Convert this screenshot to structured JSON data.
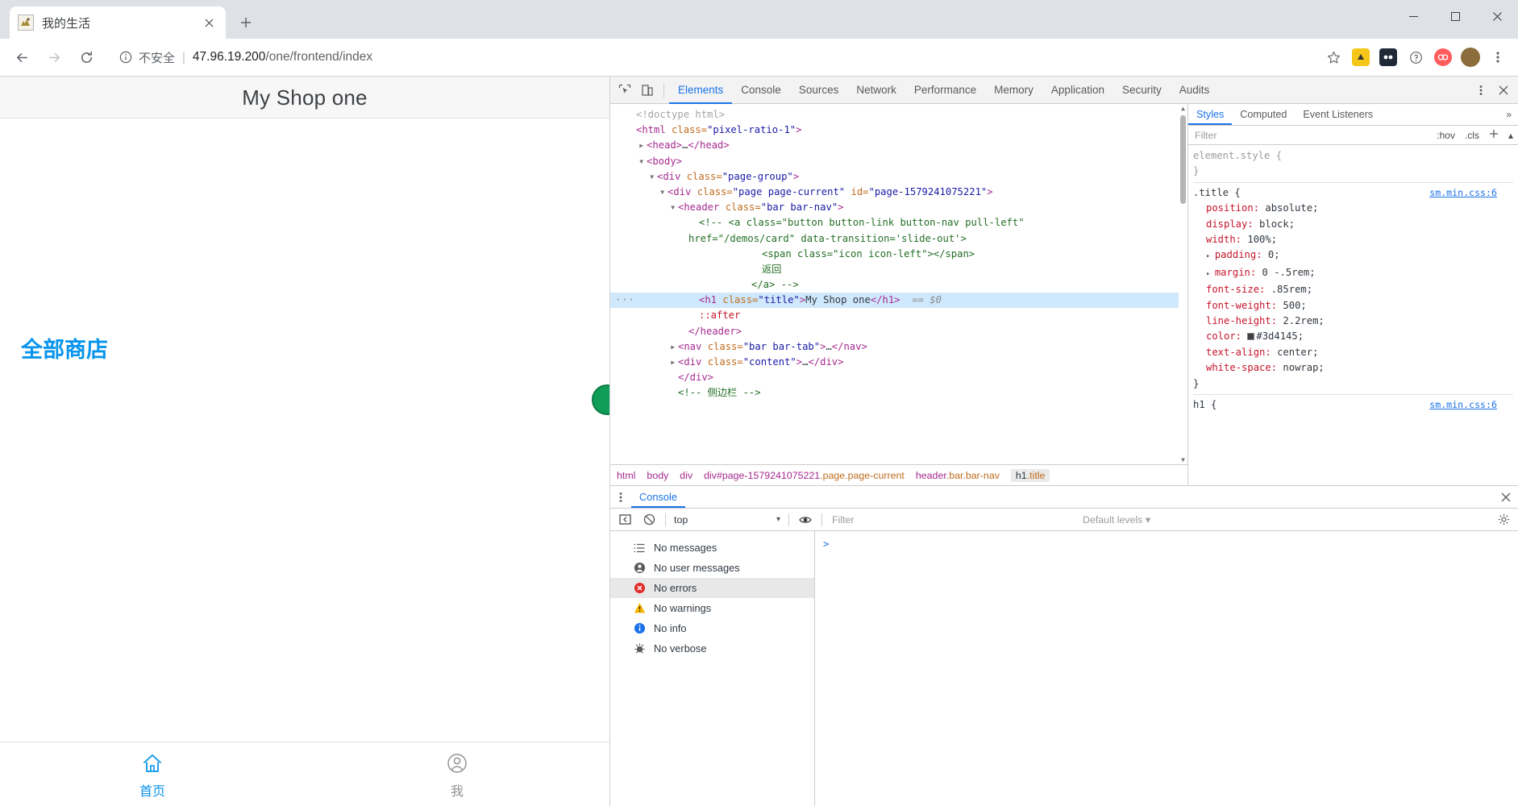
{
  "browser": {
    "tab": {
      "title": "我的生活",
      "favicon_icon": "page-favicon",
      "close_icon": "close-icon"
    },
    "newtab_icon": "plus-icon",
    "window_controls": {
      "minimize": "minimize-icon",
      "maximize": "maximize-icon",
      "close": "close-icon"
    },
    "nav": {
      "back_icon": "back-arrow-icon",
      "forward_icon": "forward-arrow-icon",
      "reload_icon": "reload-icon"
    },
    "omnibox": {
      "info_icon": "info-circle-icon",
      "security_label": "不安全",
      "separator": "|",
      "url_host": "47.96.19.200",
      "url_path": "/one/frontend/index"
    },
    "toolbar_icons": {
      "bookmark": "star-icon",
      "extension_1": "extension-yellow-icon",
      "extension_2": "extension-dark-icon",
      "help": "help-circle-icon",
      "extension_3": "extension-red-icon",
      "profile": "avatar-icon",
      "menu": "three-dot-menu-icon"
    }
  },
  "page": {
    "title": "My Shop one",
    "store_link": "全部商店",
    "tabbar": [
      {
        "label": "首页",
        "icon": "home-icon",
        "active": true
      },
      {
        "label": "我",
        "icon": "user-icon",
        "active": false
      }
    ],
    "accent_color": "#0894ec",
    "title_color": "#3d4145"
  },
  "devtools": {
    "toolbar": {
      "inspect_icon": "inspect-element-icon",
      "device_icon": "device-toolbar-icon",
      "more_icon": "three-dot-menu-icon",
      "close_icon": "close-icon",
      "tabs": [
        {
          "label": "Elements",
          "active": true
        },
        {
          "label": "Console",
          "active": false
        },
        {
          "label": "Sources",
          "active": false
        },
        {
          "label": "Network",
          "active": false
        },
        {
          "label": "Performance",
          "active": false
        },
        {
          "label": "Memory",
          "active": false
        },
        {
          "label": "Application",
          "active": false
        },
        {
          "label": "Security",
          "active": false
        },
        {
          "label": "Audits",
          "active": false
        }
      ]
    },
    "dom_lines": [
      {
        "indent": 0,
        "arrow": "",
        "selected": false,
        "parts": [
          {
            "t": "doctype",
            "s": "<!doctype html>"
          }
        ]
      },
      {
        "indent": 0,
        "arrow": "",
        "selected": false,
        "parts": [
          {
            "t": "tag",
            "s": "<html "
          },
          {
            "t": "attr",
            "s": "class="
          },
          {
            "t": "val",
            "s": "\"pixel-ratio-1\""
          },
          {
            "t": "tag",
            "s": ">"
          }
        ]
      },
      {
        "indent": 1,
        "arrow": "collapsed",
        "selected": false,
        "parts": [
          {
            "t": "tag",
            "s": "<head>"
          },
          {
            "t": "text",
            "s": "…"
          },
          {
            "t": "tag",
            "s": "</head>"
          }
        ]
      },
      {
        "indent": 1,
        "arrow": "expanded",
        "selected": false,
        "parts": [
          {
            "t": "tag",
            "s": "<body>"
          }
        ]
      },
      {
        "indent": 2,
        "arrow": "expanded",
        "selected": false,
        "parts": [
          {
            "t": "tag",
            "s": "<div "
          },
          {
            "t": "attr",
            "s": "class="
          },
          {
            "t": "val",
            "s": "\"page-group\""
          },
          {
            "t": "tag",
            "s": ">"
          }
        ]
      },
      {
        "indent": 3,
        "arrow": "expanded",
        "selected": false,
        "parts": [
          {
            "t": "tag",
            "s": "<div "
          },
          {
            "t": "attr",
            "s": "class="
          },
          {
            "t": "val",
            "s": "\"page page-current\""
          },
          {
            "t": "attr",
            "s": " id="
          },
          {
            "t": "val",
            "s": "\"page-1579241075221\""
          },
          {
            "t": "tag",
            "s": ">"
          }
        ]
      },
      {
        "indent": 4,
        "arrow": "expanded",
        "selected": false,
        "parts": [
          {
            "t": "tag",
            "s": "<header "
          },
          {
            "t": "attr",
            "s": "class="
          },
          {
            "t": "val",
            "s": "\"bar bar-nav\""
          },
          {
            "t": "tag",
            "s": ">"
          }
        ]
      },
      {
        "indent": 6,
        "arrow": "",
        "selected": false,
        "parts": [
          {
            "t": "comment",
            "s": "<!-- <a class=\"button button-link button-nav pull-left\""
          }
        ]
      },
      {
        "indent": 5,
        "arrow": "",
        "selected": false,
        "parts": [
          {
            "t": "comment",
            "s": "href=\"/demos/card\" data-transition='slide-out'>"
          }
        ]
      },
      {
        "indent": 12,
        "arrow": "",
        "selected": false,
        "parts": [
          {
            "t": "comment",
            "s": "<span class=\"icon icon-left\"></span>"
          }
        ]
      },
      {
        "indent": 12,
        "arrow": "",
        "selected": false,
        "parts": [
          {
            "t": "comment",
            "s": "返回"
          }
        ]
      },
      {
        "indent": 11,
        "arrow": "",
        "selected": false,
        "parts": [
          {
            "t": "comment",
            "s": "</a> -->"
          }
        ]
      },
      {
        "indent": 6,
        "arrow": "dots",
        "selected": true,
        "parts": [
          {
            "t": "tag",
            "s": "<h1 "
          },
          {
            "t": "attr",
            "s": "class="
          },
          {
            "t": "val",
            "s": "\"title\""
          },
          {
            "t": "tag",
            "s": ">"
          },
          {
            "t": "text",
            "s": "My Shop one"
          },
          {
            "t": "tag",
            "s": "</h1>"
          },
          {
            "t": "eq",
            "s": "  == $0"
          }
        ]
      },
      {
        "indent": 6,
        "arrow": "",
        "selected": false,
        "parts": [
          {
            "t": "pseudo",
            "s": "::after"
          }
        ]
      },
      {
        "indent": 5,
        "arrow": "",
        "selected": false,
        "parts": [
          {
            "t": "tag",
            "s": "</header>"
          }
        ]
      },
      {
        "indent": 4,
        "arrow": "collapsed",
        "selected": false,
        "parts": [
          {
            "t": "tag",
            "s": "<nav "
          },
          {
            "t": "attr",
            "s": "class="
          },
          {
            "t": "val",
            "s": "\"bar bar-tab\""
          },
          {
            "t": "tag",
            "s": ">"
          },
          {
            "t": "text",
            "s": "…"
          },
          {
            "t": "tag",
            "s": "</nav>"
          }
        ]
      },
      {
        "indent": 4,
        "arrow": "collapsed",
        "selected": false,
        "parts": [
          {
            "t": "tag",
            "s": "<div "
          },
          {
            "t": "attr",
            "s": "class="
          },
          {
            "t": "val",
            "s": "\"content\""
          },
          {
            "t": "tag",
            "s": ">"
          },
          {
            "t": "text",
            "s": "…"
          },
          {
            "t": "tag",
            "s": "</div>"
          }
        ]
      },
      {
        "indent": 4,
        "arrow": "",
        "selected": false,
        "parts": [
          {
            "t": "tag",
            "s": "</div>"
          }
        ]
      },
      {
        "indent": 4,
        "arrow": "",
        "selected": false,
        "parts": [
          {
            "t": "comment",
            "s": "<!-- 侧边栏 -->"
          }
        ]
      }
    ],
    "breadcrumb": [
      {
        "text": "html",
        "cls": ""
      },
      {
        "text": "body",
        "cls": ""
      },
      {
        "text": "div",
        "cls": ""
      },
      {
        "text": "div#page-1579241075221",
        "cls": ".page.page-current"
      },
      {
        "text": "header",
        "cls": ".bar.bar-nav"
      },
      {
        "text": "h1",
        "cls": ".title",
        "last": true
      }
    ],
    "styles": {
      "tabs": [
        {
          "label": "Styles",
          "active": true
        },
        {
          "label": "Computed",
          "active": false
        },
        {
          "label": "Event Listeners",
          "active": false
        }
      ],
      "more_icon": "chevron-double-right-icon",
      "filter_placeholder": "Filter",
      "hov_label": ":hov",
      "cls_label": ".cls",
      "new_rule_icon": "plus-icon",
      "rules": [
        {
          "selector": "element.style {",
          "selector_muted": true,
          "origin": "",
          "props": [],
          "close": "}"
        },
        {
          "selector": ".title {",
          "selector_muted": false,
          "origin": "sm.min.css:6",
          "props": [
            {
              "name": "position",
              "value": "absolute;",
              "tri": false,
              "swatch": ""
            },
            {
              "name": "display",
              "value": "block;",
              "tri": false,
              "swatch": ""
            },
            {
              "name": "width",
              "value": "100%;",
              "tri": false,
              "swatch": ""
            },
            {
              "name": "padding",
              "value": "0;",
              "tri": true,
              "swatch": ""
            },
            {
              "name": "margin",
              "value": "0 -.5rem;",
              "tri": true,
              "swatch": ""
            },
            {
              "name": "font-size",
              "value": ".85rem;",
              "tri": false,
              "swatch": ""
            },
            {
              "name": "font-weight",
              "value": "500;",
              "tri": false,
              "swatch": ""
            },
            {
              "name": "line-height",
              "value": "2.2rem;",
              "tri": false,
              "swatch": ""
            },
            {
              "name": "color",
              "value": "#3d4145;",
              "tri": false,
              "swatch": "#3d4145"
            },
            {
              "name": "text-align",
              "value": "center;",
              "tri": false,
              "swatch": ""
            },
            {
              "name": "white-space",
              "value": "nowrap;",
              "tri": false,
              "swatch": ""
            }
          ],
          "close": "}"
        },
        {
          "selector": "h1 {",
          "selector_muted": false,
          "origin": "sm.min.css:6",
          "props": [],
          "close": ""
        }
      ]
    },
    "drawer": {
      "dots_icon": "three-dot-menu-icon",
      "tab": "Console",
      "close_icon": "close-icon",
      "toolbar": {
        "sidebar_icon": "show-console-sidebar-icon",
        "clear_icon": "clear-console-icon",
        "context": "top",
        "context_caret": "▾",
        "eye_icon": "live-expression-icon",
        "filter_placeholder": "Filter",
        "levels": "Default levels ▾",
        "settings_icon": "gear-icon"
      },
      "sidebar_items": [
        {
          "label": "No messages",
          "icon": "list-icon",
          "selected": false
        },
        {
          "label": "No user messages",
          "icon": "user-icon",
          "selected": false
        },
        {
          "label": "No errors",
          "icon": "error-icon",
          "selected": true
        },
        {
          "label": "No warnings",
          "icon": "warning-icon",
          "selected": false
        },
        {
          "label": "No info",
          "icon": "info-icon",
          "selected": false
        },
        {
          "label": "No verbose",
          "icon": "verbose-icon",
          "selected": false
        }
      ],
      "prompt": ">"
    }
  }
}
